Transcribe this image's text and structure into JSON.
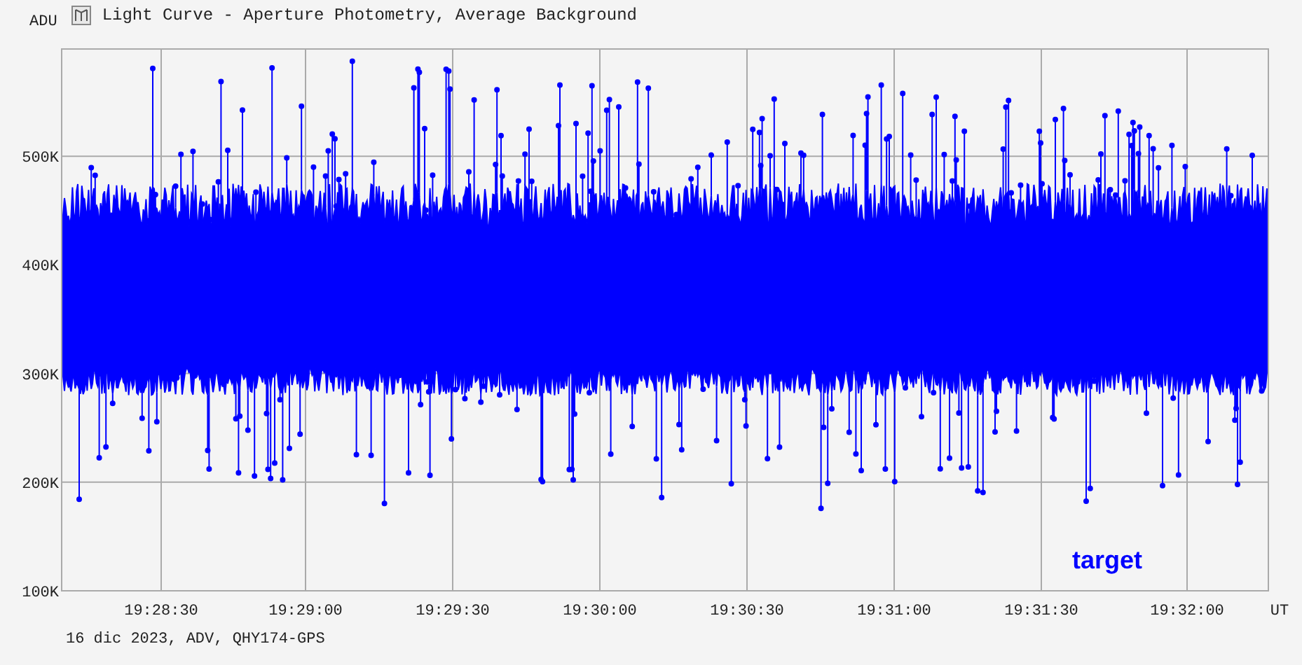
{
  "window": {
    "title": "Light Curve - Aperture Photometry, Average Background"
  },
  "y_axis": {
    "unit": "ADU",
    "ticks": [
      "500K",
      "400K",
      "300K",
      "200K",
      "100K"
    ]
  },
  "x_axis": {
    "unit": "UT",
    "ticks": [
      "19:28:30",
      "19:29:00",
      "19:29:30",
      "19:30:00",
      "19:30:30",
      "19:31:00",
      "19:31:30",
      "19:32:00"
    ]
  },
  "series_label": "target",
  "footer": "16 dic 2023, ADV, QHY174-GPS"
}
